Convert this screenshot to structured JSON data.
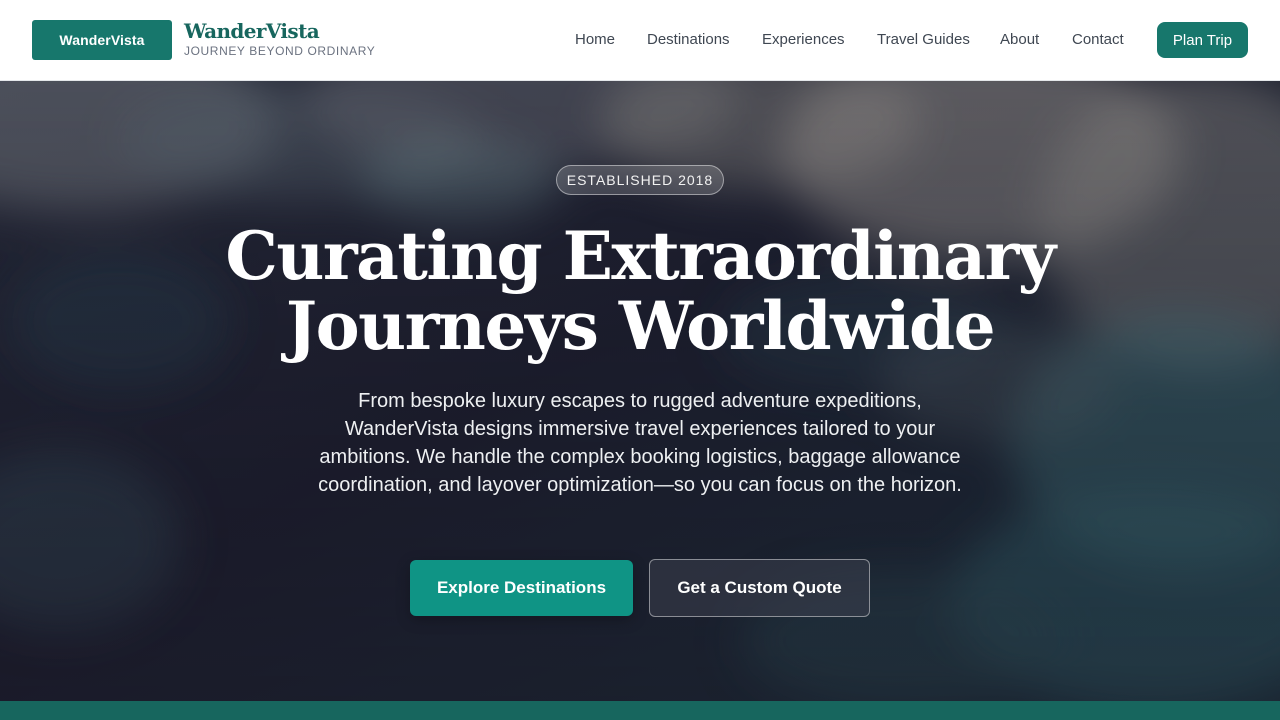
{
  "header": {
    "logo_text": "WanderVista",
    "brand_name": "WanderVista",
    "tagline": "JOURNEY BEYOND ORDINARY",
    "nav": [
      {
        "label": "Home"
      },
      {
        "label": "Destinations"
      },
      {
        "label": "Experiences"
      },
      {
        "label": "Travel Guides"
      },
      {
        "label": "About"
      },
      {
        "label": "Contact"
      }
    ],
    "cta_label": "Plan Trip"
  },
  "hero": {
    "badge": "ESTABLISHED 2018",
    "title_line1": "Curating Extraordinary",
    "title_line2": "Journeys Worldwide",
    "subtitle": "From bespoke luxury escapes to rugged adventure expeditions, WanderVista designs immersive travel experiences tailored to your ambitions. We handle the complex booking logistics, baggage allowance coordination, and layover optimization—so you can focus on the horizon.",
    "primary_button": "Explore Destinations",
    "secondary_button": "Get a Custom Quote"
  },
  "colors": {
    "brand": "#17776c",
    "brand_dark": "#17665e",
    "primary_button": "#0f9485",
    "hero_dark": "#1b1d2b"
  }
}
